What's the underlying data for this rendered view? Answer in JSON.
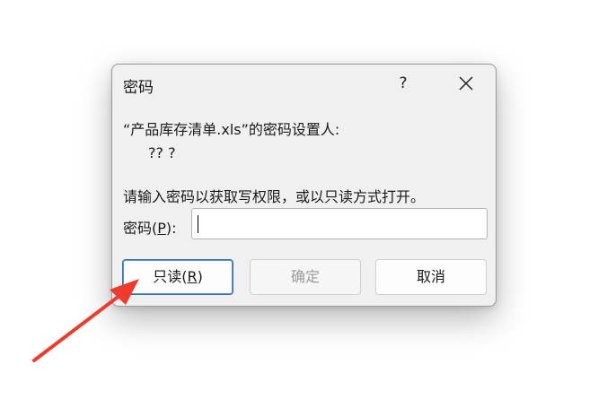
{
  "dialog": {
    "title": "密码",
    "help_label": "?",
    "message_line1": "“产品库存清单.xls”的密码设置人:",
    "message_line2": "?? ?",
    "message_line3": "请输入密码以获取写权限，或以只读方式打开。",
    "password_label_prefix": "密码(",
    "password_label_key": "P",
    "password_label_suffix": "):",
    "password_value": "",
    "buttons": {
      "readonly_prefix": "只读(",
      "readonly_key": "R",
      "readonly_suffix": ")",
      "ok": "确定",
      "cancel": "取消"
    }
  },
  "colors": {
    "annotation_arrow": "#f03a2c",
    "focus_border": "#2f6fb1"
  },
  "icons": [
    "close-icon"
  ]
}
